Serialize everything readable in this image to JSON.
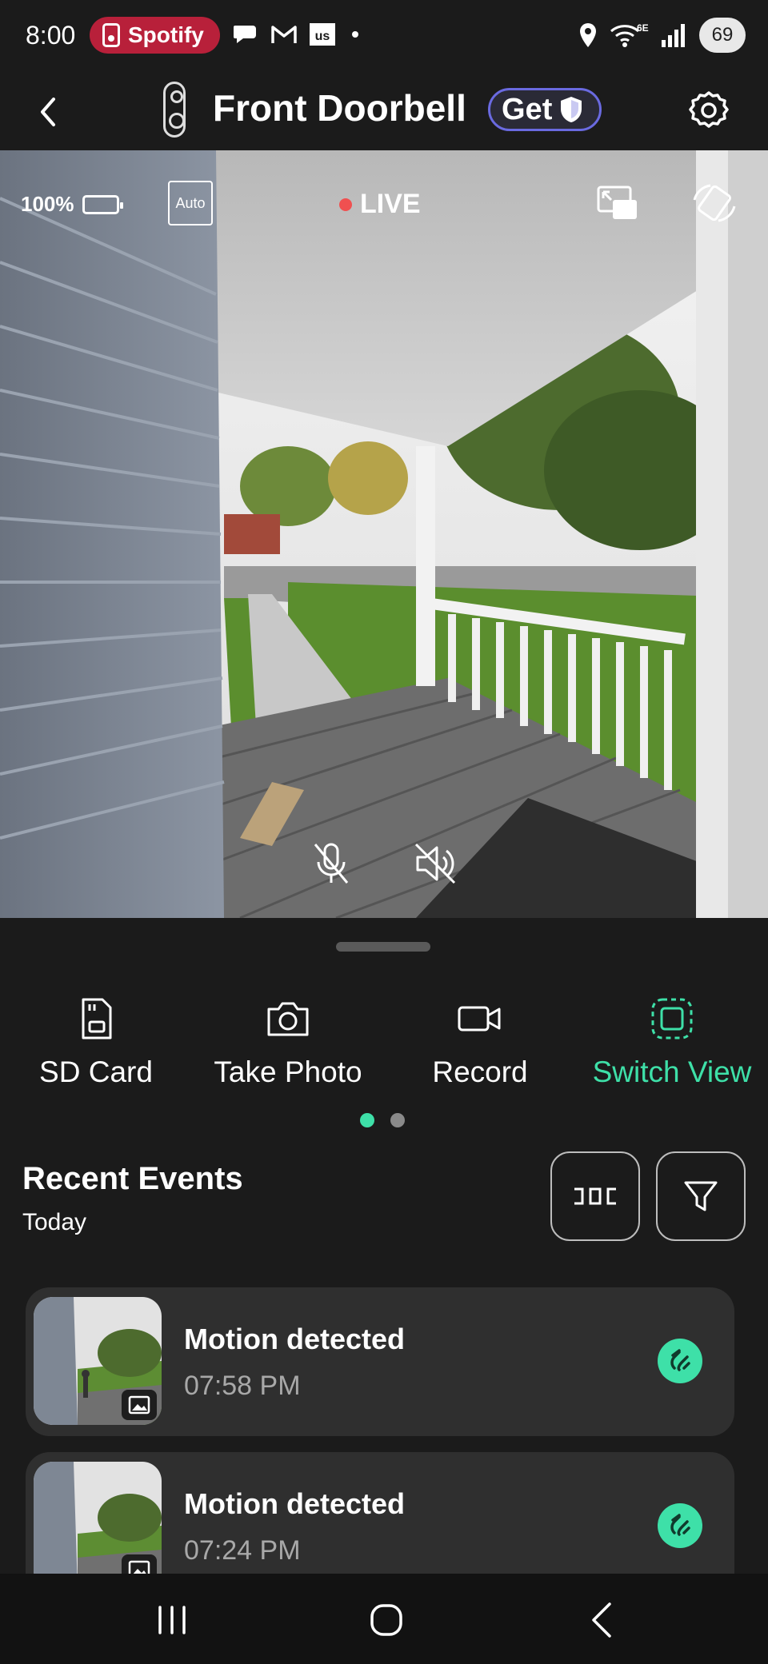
{
  "status_bar": {
    "time": "8:00",
    "spotify_label": "Spotify",
    "battery_level": "69",
    "left_icons": [
      "chat-icon",
      "gmail-icon",
      "us-app-icon"
    ],
    "right_icons": [
      "location-icon",
      "wifi-6e-icon",
      "signal-icon"
    ],
    "wifi_label": "6E"
  },
  "header": {
    "title": "Front Doorbell",
    "get_label": "Get"
  },
  "live_view": {
    "battery_percent": "100%",
    "auto_label": "Auto",
    "live_label": "LIVE"
  },
  "controls": [
    {
      "label": "SD Card",
      "icon": "sd-card-icon",
      "active": false
    },
    {
      "label": "Take Photo",
      "icon": "camera-icon",
      "active": false
    },
    {
      "label": "Record",
      "icon": "video-icon",
      "active": false
    },
    {
      "label": "Switch View",
      "icon": "switch-view-icon",
      "active": true
    }
  ],
  "pager": {
    "pages": 2,
    "current": 1
  },
  "recent_events": {
    "title": "Recent Events",
    "subtitle": "Today",
    "events": [
      {
        "title": "Motion detected",
        "time": "07:58 PM",
        "type_icon": "motion-icon"
      },
      {
        "title": "Motion detected",
        "time": "07:24 PM",
        "type_icon": "motion-icon"
      }
    ]
  },
  "colors": {
    "accent": "#3ee0a8",
    "background": "#1b1b1b",
    "card": "#2f2f2f",
    "live_dot": "#f05050",
    "spotify_pill": "#b8203a",
    "get_border": "#6a6ae0"
  }
}
